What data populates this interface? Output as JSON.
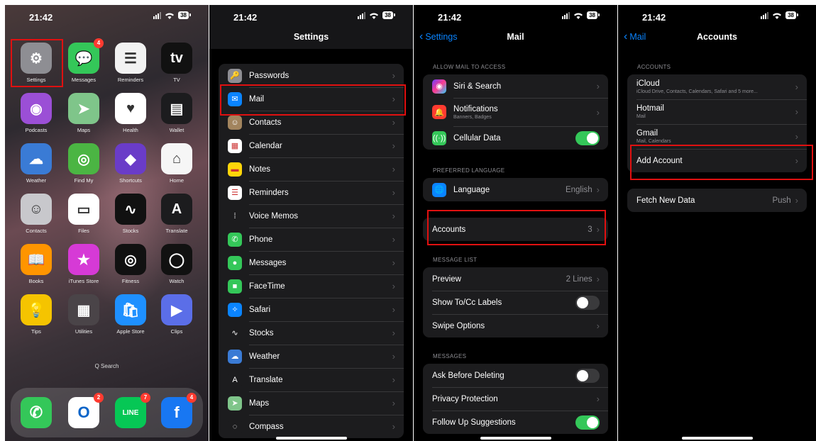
{
  "status": {
    "time": "21:42",
    "battery": "38"
  },
  "home": {
    "apps": [
      {
        "label": "Settings",
        "icon": "gear-icon",
        "bg": "#8e8e93",
        "glyph": "⚙",
        "badge": ""
      },
      {
        "label": "Messages",
        "icon": "message-bubble-icon",
        "bg": "#34c759",
        "glyph": "💬",
        "badge": "4"
      },
      {
        "label": "Reminders",
        "icon": "list-icon",
        "bg": "#f2f2f2",
        "glyph": "☰",
        "badge": ""
      },
      {
        "label": "TV",
        "icon": "appletv-icon",
        "bg": "#111111",
        "glyph": "tv",
        "badge": ""
      },
      {
        "label": "Podcasts",
        "icon": "podcast-icon",
        "bg": "#9b4fd6",
        "glyph": "◉",
        "badge": ""
      },
      {
        "label": "Maps",
        "icon": "map-icon",
        "bg": "#7fc58a",
        "glyph": "➤",
        "badge": ""
      },
      {
        "label": "Health",
        "icon": "heart-icon",
        "bg": "#ffffff",
        "glyph": "♥",
        "badge": ""
      },
      {
        "label": "Wallet",
        "icon": "wallet-icon",
        "bg": "#1c1c1e",
        "glyph": "▤",
        "badge": ""
      },
      {
        "label": "Weather",
        "icon": "cloud-icon",
        "bg": "#3a7bd5",
        "glyph": "☁",
        "badge": ""
      },
      {
        "label": "Find My",
        "icon": "find-my-icon",
        "bg": "#4bb543",
        "glyph": "◎",
        "badge": ""
      },
      {
        "label": "Shortcuts",
        "icon": "shortcuts-icon",
        "bg": "#6a3cc8",
        "glyph": "◆",
        "badge": ""
      },
      {
        "label": "Home",
        "icon": "house-icon",
        "bg": "#f6f6f6",
        "glyph": "⌂",
        "badge": ""
      },
      {
        "label": "Contacts",
        "icon": "contact-icon",
        "bg": "#c8c8cc",
        "glyph": "☺",
        "badge": ""
      },
      {
        "label": "Files",
        "icon": "folder-icon",
        "bg": "#ffffff",
        "glyph": "▭",
        "badge": ""
      },
      {
        "label": "Stocks",
        "icon": "stocks-icon",
        "bg": "#111111",
        "glyph": "∿",
        "badge": ""
      },
      {
        "label": "Translate",
        "icon": "translate-icon",
        "bg": "#1c1c1e",
        "glyph": "A",
        "badge": ""
      },
      {
        "label": "Books",
        "icon": "book-icon",
        "bg": "#ff9500",
        "glyph": "📖",
        "badge": ""
      },
      {
        "label": "iTunes Store",
        "icon": "star-icon",
        "bg": "#d63ad6",
        "glyph": "★",
        "badge": ""
      },
      {
        "label": "Fitness",
        "icon": "rings-icon",
        "bg": "#111111",
        "glyph": "◎",
        "badge": ""
      },
      {
        "label": "Watch",
        "icon": "watch-icon",
        "bg": "#111111",
        "glyph": "◯",
        "badge": ""
      },
      {
        "label": "Tips",
        "icon": "lightbulb-icon",
        "bg": "#f5c400",
        "glyph": "💡",
        "badge": ""
      },
      {
        "label": "Utilities",
        "icon": "folder-grid-icon",
        "bg": "#4a4448",
        "glyph": "▦",
        "badge": ""
      },
      {
        "label": "Apple Store",
        "icon": "bag-icon",
        "bg": "#1e90ff",
        "glyph": "🛍",
        "badge": ""
      },
      {
        "label": "Clips",
        "icon": "camera-clips-icon",
        "bg": "#5b6ee8",
        "glyph": "▶",
        "badge": ""
      }
    ],
    "search": "Q Search",
    "dock": [
      {
        "icon": "phone-icon",
        "bg": "#34c759",
        "glyph": "✆",
        "badge": ""
      },
      {
        "icon": "outlook-icon",
        "bg": "#ffffff",
        "glyph": "O",
        "badge": "2"
      },
      {
        "icon": "line-icon",
        "bg": "#06c755",
        "glyph": "LINE",
        "badge": "7"
      },
      {
        "icon": "facebook-icon",
        "bg": "#1877f2",
        "glyph": "f",
        "badge": "4"
      }
    ]
  },
  "settings": {
    "title": "Settings",
    "items": [
      {
        "label": "Passwords",
        "icon": "key-icon",
        "bg": "#8e8e93",
        "glyph": "🔑"
      },
      {
        "label": "Mail",
        "icon": "mail-icon",
        "bg": "#0a84ff",
        "glyph": "✉"
      },
      {
        "label": "Contacts",
        "icon": "contact-icon",
        "bg": "#a2845e",
        "glyph": "☺"
      },
      {
        "label": "Calendar",
        "icon": "calendar-icon",
        "bg": "#ffffff",
        "glyph": "▦"
      },
      {
        "label": "Notes",
        "icon": "notes-icon",
        "bg": "#ffd60a",
        "glyph": "▬"
      },
      {
        "label": "Reminders",
        "icon": "reminders-icon",
        "bg": "#ffffff",
        "glyph": "☰"
      },
      {
        "label": "Voice Memos",
        "icon": "waveform-icon",
        "bg": "#1c1c1e",
        "glyph": "⁞"
      },
      {
        "label": "Phone",
        "icon": "phone-icon",
        "bg": "#34c759",
        "glyph": "✆"
      },
      {
        "label": "Messages",
        "icon": "message-bubble-icon",
        "bg": "#34c759",
        "glyph": "●"
      },
      {
        "label": "FaceTime",
        "icon": "video-icon",
        "bg": "#34c759",
        "glyph": "■"
      },
      {
        "label": "Safari",
        "icon": "compass-safari-icon",
        "bg": "#0a84ff",
        "glyph": "✧"
      },
      {
        "label": "Stocks",
        "icon": "stocks-icon",
        "bg": "#1c1c1e",
        "glyph": "∿"
      },
      {
        "label": "Weather",
        "icon": "cloud-icon",
        "bg": "#3a7bd5",
        "glyph": "☁"
      },
      {
        "label": "Translate",
        "icon": "translate-icon",
        "bg": "#1c1c1e",
        "glyph": "A"
      },
      {
        "label": "Maps",
        "icon": "map-icon",
        "bg": "#7fc58a",
        "glyph": "➤"
      },
      {
        "label": "Compass",
        "icon": "compass-icon",
        "bg": "#1c1c1e",
        "glyph": "◌"
      }
    ]
  },
  "mail": {
    "back": "Settings",
    "title": "Mail",
    "allow_header": "ALLOW MAIL TO ACCESS",
    "siri": "Siri & Search",
    "notifications": "Notifications",
    "notifications_sub": "Banners, Badges",
    "cellular": "Cellular Data",
    "lang_header": "PREFERRED LANGUAGE",
    "language": "Language",
    "language_val": "English",
    "accounts": "Accounts",
    "accounts_val": "3",
    "list_header": "MESSAGE LIST",
    "preview": "Preview",
    "preview_val": "2 Lines",
    "tocc": "Show To/Cc Labels",
    "swipe": "Swipe Options",
    "messages_header": "MESSAGES",
    "ask_delete": "Ask Before Deleting",
    "privacy": "Privacy Protection",
    "follow_up": "Follow Up Suggestions"
  },
  "accounts": {
    "back": "Mail",
    "title": "Accounts",
    "header": "ACCOUNTS",
    "list": [
      {
        "name": "iCloud",
        "sub": "iCloud Drive, Contacts, Calendars, Safari and 5 more..."
      },
      {
        "name": "Hotmail",
        "sub": "Mail"
      },
      {
        "name": "Gmail",
        "sub": "Mail, Calendars"
      }
    ],
    "add": "Add Account",
    "fetch": "Fetch New Data",
    "fetch_val": "Push"
  },
  "colors": {
    "highlight": "#e01010",
    "accent": "#0a84ff",
    "toggle_on": "#34c759"
  }
}
